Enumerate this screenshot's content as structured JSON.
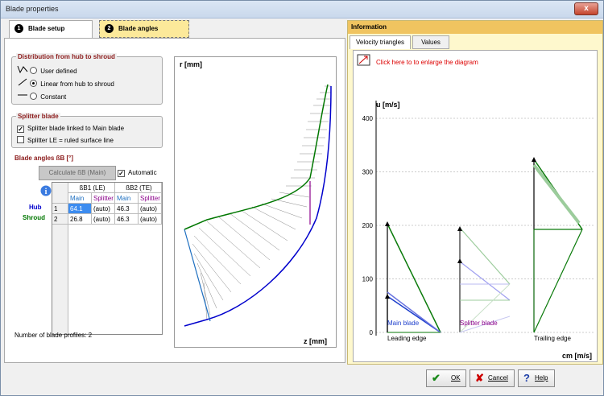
{
  "window": {
    "title": "Blade properties",
    "close": "x"
  },
  "tabs": [
    {
      "num": "1",
      "label": "Blade setup"
    },
    {
      "num": "2",
      "label": "Blade angles"
    }
  ],
  "distribution": {
    "title": "Distribution from hub to shroud",
    "options": [
      "User defined",
      "Linear from hub to shroud",
      "Constant"
    ],
    "selected": 1
  },
  "splitter": {
    "title": "Splitter blade",
    "options": [
      "Splitter blade linked to Main blade",
      "Splitter LE = ruled surface line"
    ],
    "checked": [
      true,
      false
    ]
  },
  "angles": {
    "title": "Blade angles ßB [°]",
    "calc_button": "Calculate ßB (Main)",
    "automatic_label": "Automatic",
    "automatic": true,
    "col_groups": [
      "ßB1 (LE)",
      "ßB2 (TE)"
    ],
    "col_sub": [
      "Main",
      "Splitter",
      "Main",
      "Splitter"
    ],
    "rows": [
      {
        "label": "Hub",
        "num": "1",
        "values": [
          "64.1",
          "(auto)",
          "46.3",
          "(auto)"
        ]
      },
      {
        "label": "Shroud",
        "num": "2",
        "values": [
          "26.8",
          "(auto)",
          "46.3",
          "(auto)"
        ]
      }
    ]
  },
  "profiles_text": "Number of blade profiles: 2",
  "meridional": {
    "ylabel": "r [mm]",
    "xlabel": "z [mm]"
  },
  "info": {
    "title": "Information",
    "tabs": [
      "Velocity triangles",
      "Values"
    ],
    "enlarge": "Click here to to enlarge the diagram"
  },
  "chart_data": {
    "type": "line",
    "title": "",
    "ylabel": "u [m/s]",
    "xlabel": "cm [m/s]",
    "ylim": [
      0,
      400
    ],
    "yticks": [
      "0",
      "100",
      "200",
      "300",
      "400"
    ],
    "annotations": [
      "Main blade",
      "Leading edge",
      "Splitter blade",
      "Trailing edge"
    ]
  },
  "buttons": {
    "ok": "OK",
    "cancel": "Cancel",
    "help": "Help"
  },
  "colors": {
    "accent_tab": "#fce99a",
    "info_bg": "#fef8cd",
    "info_header": "#f0c460",
    "hub": "#0000cc",
    "shroud": "#007700"
  }
}
